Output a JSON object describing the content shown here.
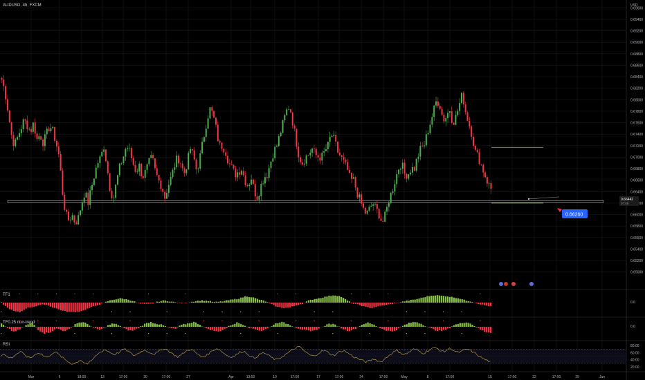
{
  "header": {
    "symbol_title": "AUDUSD, 4h, FXCM",
    "currency": "USD"
  },
  "colors": {
    "background": "#000000",
    "up": "#4caf50",
    "down": "#f23645",
    "grid": "#1c1c1c",
    "pane_border": "#363a45",
    "osc_up": "#8bc34a",
    "osc_down": "#f23645",
    "rsi_line": "#c9a84a",
    "level_line": "#7fae3f",
    "price_label": "#2962ff"
  },
  "chart_data": [
    {
      "type": "candlestick",
      "title": "AUDUSD, 4h, FXCM",
      "ylabel": "USD",
      "ylim": [
        0.649,
        0.697
      ],
      "y_ticks": [
        "0.69600",
        "0.69400",
        "0.69200",
        "0.69000",
        "0.68800",
        "0.68600",
        "0.68400",
        "0.68200",
        "0.68000",
        "0.67800",
        "0.67600",
        "0.67400",
        "0.67200",
        "0.67000",
        "0.66800",
        "0.66600",
        "0.66400",
        "0.66200",
        "0.66000",
        "0.65800",
        "0.65600",
        "0.65400",
        "0.65200",
        "0.65000"
      ],
      "x_ticks": [
        "Mar",
        "6",
        "18:00",
        "13",
        "17:00",
        "20",
        "17:00",
        "27",
        "Apr",
        "13:00",
        "10",
        "17:00",
        "17",
        "17:00",
        "24",
        "17:00",
        "May",
        "8",
        "17:00",
        "15",
        "17:00",
        "22",
        "17:00",
        "29",
        "Jun"
      ],
      "close_path": [
        0.6835,
        0.6815,
        0.678,
        0.674,
        0.672,
        0.6735,
        0.675,
        0.6765,
        0.6755,
        0.6745,
        0.676,
        0.673,
        0.674,
        0.6725,
        0.674,
        0.6755,
        0.6745,
        0.6725,
        0.67,
        0.664,
        0.66,
        0.659,
        0.66,
        0.6585,
        0.6595,
        0.662,
        0.664,
        0.662,
        0.6645,
        0.667,
        0.669,
        0.67,
        0.672,
        0.668,
        0.664,
        0.663,
        0.666,
        0.6685,
        0.67,
        0.672,
        0.671,
        0.669,
        0.6675,
        0.6685,
        0.6665,
        0.6675,
        0.669,
        0.67,
        0.6675,
        0.666,
        0.665,
        0.663,
        0.665,
        0.6665,
        0.6685,
        0.67,
        0.669,
        0.667,
        0.669,
        0.6715,
        0.67,
        0.6675,
        0.67,
        0.673,
        0.676,
        0.6785,
        0.6775,
        0.675,
        0.672,
        0.672,
        0.671,
        0.669,
        0.668,
        0.667,
        0.6675,
        0.668,
        0.666,
        0.665,
        0.6665,
        0.664,
        0.663,
        0.665,
        0.6665,
        0.667,
        0.669,
        0.671,
        0.672,
        0.674,
        0.676,
        0.678,
        0.679,
        0.676,
        0.673,
        0.67,
        0.669,
        0.67,
        0.6705,
        0.6715,
        0.6705,
        0.67,
        0.67,
        0.671,
        0.672,
        0.674,
        0.673,
        0.671,
        0.67,
        0.669,
        0.668,
        0.666,
        0.666,
        0.664,
        0.6625,
        0.661,
        0.66,
        0.661,
        0.662,
        0.661,
        0.66,
        0.6585,
        0.66,
        0.6625,
        0.664,
        0.666,
        0.668,
        0.669,
        0.667,
        0.667,
        0.668,
        0.668,
        0.67,
        0.6715,
        0.672,
        0.674,
        0.676,
        0.678,
        0.68,
        0.679,
        0.6765,
        0.677,
        0.6785,
        0.676,
        0.677,
        0.679,
        0.681,
        0.678,
        0.676,
        0.674,
        0.671,
        0.67,
        0.6685,
        0.667,
        0.6655,
        0.6645
      ],
      "series": [
        {
          "name": "0.66260",
          "value": 0.6626
        },
        {
          "name": "0.66442",
          "value": 0.66442
        }
      ],
      "levels": [
        {
          "kind": "horizontal_line",
          "value": 0.6717
        },
        {
          "kind": "horizontal_line",
          "value": 0.662
        },
        {
          "kind": "rectangle_zone",
          "value_low": 0.66215,
          "value_high": 0.66245
        },
        {
          "kind": "price_label_line",
          "value": 0.6626
        }
      ],
      "current_price": "0.66442",
      "countdown": "07:09",
      "price_label": "0.66260"
    },
    {
      "type": "bar",
      "title": "TF1",
      "y_ticks": [
        "0.0"
      ],
      "wave": [
        0,
        -10,
        -16,
        -18,
        -10,
        -8,
        -5,
        -3,
        -8,
        -12,
        -16,
        -18,
        -17,
        -15,
        -10,
        -6,
        -2,
        3,
        6,
        8,
        6,
        3,
        -2,
        -3,
        -2,
        2,
        4,
        2,
        0,
        -1,
        1,
        3,
        4,
        3,
        1,
        2,
        4,
        6,
        8,
        12,
        10,
        6,
        3,
        -3,
        -8,
        -10,
        -9,
        -5,
        -2,
        4,
        7,
        9,
        12,
        14,
        12,
        5,
        -2,
        -4,
        -8,
        -10,
        -7,
        -5,
        -3,
        -1,
        2,
        4,
        6,
        9,
        12,
        14,
        13,
        12,
        10,
        8,
        4,
        2,
        -2,
        -5,
        -7
      ]
    },
    {
      "type": "bar",
      "title": "TF0.25 non-trend",
      "y_ticks": [
        "0.0"
      ],
      "wave": [
        4,
        -2,
        -6,
        -3,
        2,
        5,
        -4,
        -8,
        -6,
        -2,
        -5,
        -3,
        4,
        6,
        3,
        -2,
        -4,
        1,
        4,
        2,
        -3,
        -5,
        -2,
        3,
        6,
        4,
        2,
        -1,
        -3,
        2,
        4,
        6,
        3,
        -2,
        -4,
        -6,
        -3,
        2,
        5,
        3,
        -1,
        -3,
        -5,
        -2,
        3,
        6,
        4,
        1,
        -2,
        -4,
        -6,
        -3,
        1,
        4,
        2,
        -2,
        -5,
        -3,
        2,
        5,
        3,
        -1,
        -4,
        -6,
        -3,
        2,
        5,
        6,
        3,
        -1,
        -4,
        -5,
        -3,
        2,
        4,
        6,
        3,
        -2,
        -6,
        -7
      ]
    },
    {
      "type": "line",
      "title": "RSI",
      "ylim": [
        10,
        90
      ],
      "y_ticks": [
        "80.00",
        "60.00",
        "40.00",
        "20.00"
      ],
      "bands": [
        30,
        70
      ],
      "values": [
        52,
        55,
        48,
        45,
        50,
        58,
        62,
        55,
        48,
        45,
        52,
        60,
        58,
        50,
        46,
        55,
        62,
        58,
        50,
        42,
        36,
        30,
        28,
        34,
        40,
        32,
        28,
        34,
        45,
        55,
        62,
        68,
        65,
        60,
        55,
        58,
        64,
        70,
        66,
        58,
        52,
        56,
        62,
        68,
        64,
        60,
        56,
        60,
        66,
        72,
        68,
        60,
        54,
        48,
        52,
        60,
        66,
        70,
        64,
        56,
        50,
        48,
        54,
        62,
        68,
        72,
        66,
        58,
        52,
        48,
        50,
        56,
        62,
        64,
        58,
        50,
        44,
        50,
        56,
        60,
        54,
        48,
        42,
        40,
        46,
        52,
        58,
        64,
        70,
        76,
        74,
        66,
        58,
        52,
        50,
        56,
        62,
        66,
        62,
        56,
        52,
        58,
        64,
        66,
        60,
        54,
        48,
        44,
        40,
        36,
        34,
        38,
        42,
        38,
        34,
        40,
        48,
        56,
        62,
        66,
        60,
        54,
        58,
        64,
        70,
        68,
        62,
        58,
        64,
        70,
        74,
        72,
        66,
        62,
        68,
        72,
        66,
        60,
        62,
        66,
        70,
        66,
        60,
        54,
        48,
        42,
        38,
        34
      ]
    }
  ]
}
